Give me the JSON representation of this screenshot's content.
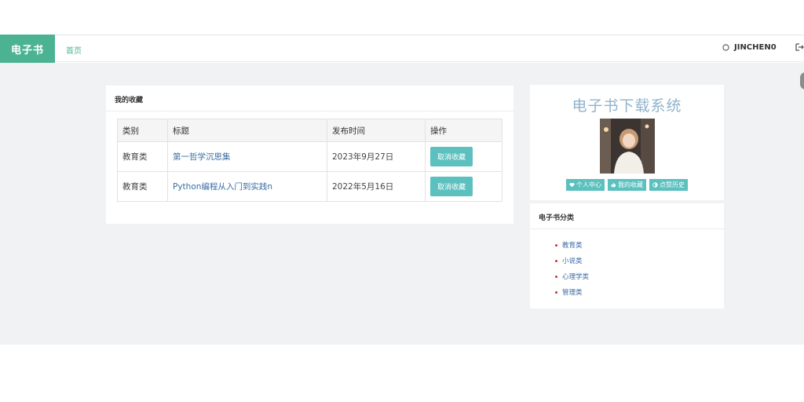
{
  "navbar": {
    "brand": "电子书",
    "home_link": "首页",
    "username": "JINCHEN0"
  },
  "favorites": {
    "panel_title": "我的收藏",
    "columns": [
      "类别",
      "标题",
      "发布时间",
      "操作"
    ],
    "rows": [
      {
        "category": "教育类",
        "title": "第一哲学沉思集",
        "date": "2023年9月27日",
        "action": "取消收藏"
      },
      {
        "category": "教育类",
        "title": "Python编程从入门到实践n",
        "date": "2022年5月16日",
        "action": "取消收藏"
      }
    ]
  },
  "sidebar": {
    "site_title": "电子书下载系统",
    "links": [
      {
        "icon": "heart-icon",
        "label": "个人中心"
      },
      {
        "icon": "thumbs-up-icon",
        "label": "我的收藏"
      },
      {
        "icon": "half-circle-icon",
        "label": "点赞历史"
      }
    ],
    "category_title": "电子书分类",
    "categories": [
      "教育类",
      "小说类",
      "心理学类",
      "管理类"
    ]
  },
  "colors": {
    "brand": "#4bb392",
    "button": "#5bc0be",
    "link": "#3a6ea5",
    "background": "#f1f2f4"
  }
}
